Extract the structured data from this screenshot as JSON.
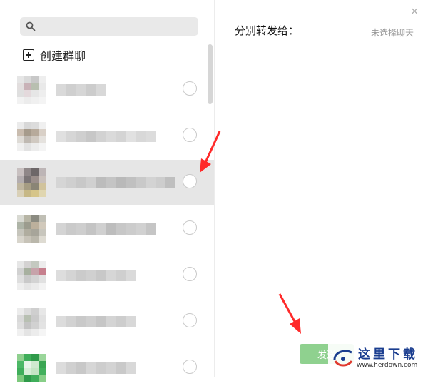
{
  "search": {
    "placeholder": ""
  },
  "create_group": {
    "label": "创建群聊"
  },
  "contacts": [
    {
      "avatar": [
        "#e6e6e6",
        "#d9d9d9",
        "#c8c8c8",
        "#eeeeee",
        "#e2dede",
        "#c9b2b7",
        "#b8bfb0",
        "#e9e9e9",
        "#dfdfdf",
        "#e4d9dc",
        "#e6e6e6",
        "#eeeeee",
        "#f2f2f2",
        "#ececec",
        "#f0f0f0",
        "#f4f4f4"
      ],
      "name": [
        "#d9d9d9",
        "#cfcfcf",
        "#d6d6d6",
        "#cccccc",
        "#d8d8d8"
      ],
      "selected": false
    },
    {
      "avatar": [
        "#ebebeb",
        "#d8d8d8",
        "#dcdcdc",
        "#f0f0f0",
        "#c9bcaf",
        "#a69b8c",
        "#b7aa9b",
        "#d9d0c7",
        "#dedbd6",
        "#bfb9b2",
        "#d0c9c1",
        "#e5e2de",
        "#f0f0f0",
        "#e2e2e2",
        "#ececec",
        "#f4f4f4"
      ],
      "name": [
        "#e0e0e0",
        "#d6d6d6",
        "#cfcfcf",
        "#c7c7c7",
        "#d2d2d2",
        "#dadada",
        "#d4d4d4",
        "#e1e1e1",
        "#d8d8d8",
        "#dcdcdc"
      ],
      "selected": false
    },
    {
      "avatar": [
        "#c8c0c0",
        "#8f8788",
        "#6d6768",
        "#bdb5b6",
        "#b3adaf",
        "#7b7576",
        "#9a8e8a",
        "#c9c0bb",
        "#bfb6a0",
        "#a59c83",
        "#8a8575",
        "#d1c39c",
        "#d9d0b7",
        "#c7b886",
        "#d6c58a",
        "#e0d6b0"
      ],
      "name": [
        "#d5d5d5",
        "#cfcfcf",
        "#c8c8c8",
        "#d0d0d0",
        "#bcbcbc",
        "#c4c4c4",
        "#b9b9b9",
        "#c0c0c0",
        "#c9c9c9",
        "#d3d3d3",
        "#cdcdcd",
        "#bfbfbf"
      ],
      "selected": true
    },
    {
      "avatar": [
        "#d9dad3",
        "#b7b5a5",
        "#8b8b81",
        "#c0bfb5",
        "#aeb4a7",
        "#9c9c8e",
        "#bcb09c",
        "#d1c9bb",
        "#c6c5bc",
        "#b0ad9f",
        "#a7a59a",
        "#c8c6bd",
        "#d8d5cc",
        "#c7c3b8",
        "#bab7ab",
        "#dedbd2"
      ],
      "name": [
        "#d4d4d4",
        "#cacaca",
        "#cecece",
        "#c4c4c4",
        "#d0d0d0",
        "#bdbdbd",
        "#c7c7c7",
        "#cccccc",
        "#d1d1d1",
        "#c5c5c5"
      ],
      "selected": false
    },
    {
      "avatar": [
        "#e6e6e6",
        "#d4d2d2",
        "#c4c9c0",
        "#ececec",
        "#d1d1d1",
        "#a7b09f",
        "#c7a3aa",
        "#c67f8d",
        "#dedede",
        "#c9c9c9",
        "#d3d3d3",
        "#e1e1e1",
        "#eeeeee",
        "#e5e5e5",
        "#ebebeb",
        "#f3f3f3"
      ],
      "name": [
        "#dddddd",
        "#d4d4d4",
        "#cbcbcb",
        "#d0d0d0",
        "#c8c8c8",
        "#d6d6d6",
        "#cfcfcf",
        "#dadada"
      ],
      "selected": false
    },
    {
      "avatar": [
        "#ececec",
        "#dcdcdc",
        "#cfcfcf",
        "#e7e7e7",
        "#d9d9d9",
        "#b8c0b2",
        "#cacaca",
        "#e1e1e1",
        "#dedede",
        "#c4c4c4",
        "#d1d1d1",
        "#e3e3e3",
        "#f0f0f0",
        "#e4e4e4",
        "#ececec",
        "#f5f5f5"
      ],
      "name": [
        "#dcdcdc",
        "#d2d2d2",
        "#c9c9c9",
        "#cfcfcf",
        "#c6c6c6",
        "#d4d4d4",
        "#cdcdcd",
        "#d8d8d8"
      ],
      "selected": false
    },
    {
      "avatar": [
        "#8fd08f",
        "#3fae5a",
        "#2f9a4a",
        "#9ad69a",
        "#4cb866",
        "#e9f5e9",
        "#cfe9cf",
        "#3aa653",
        "#3fae5a",
        "#d6eed6",
        "#c4e5c4",
        "#42b05c",
        "#7cc97c",
        "#2f9a4a",
        "#3fae5a",
        "#88cf88"
      ],
      "name": [
        "#dcdcdc",
        "#d0d0d0",
        "#c8c8c8",
        "#d6d6d6",
        "#cdcdcd",
        "#d3d3d3",
        "#c9c9c9",
        "#d8d8d8"
      ],
      "selected": false
    }
  ],
  "right_panel": {
    "title": "分别转发给：",
    "status": "未选择聊天",
    "send_label": "发送",
    "cancel_label": "",
    "close_glyph": "×"
  },
  "watermark": {
    "text": "这里下载",
    "url": "www.herdown.com"
  },
  "colors": {
    "send_button": "#8fd18f",
    "arrow": "#ff2a2a",
    "selected_row": "#e6e6e6"
  }
}
